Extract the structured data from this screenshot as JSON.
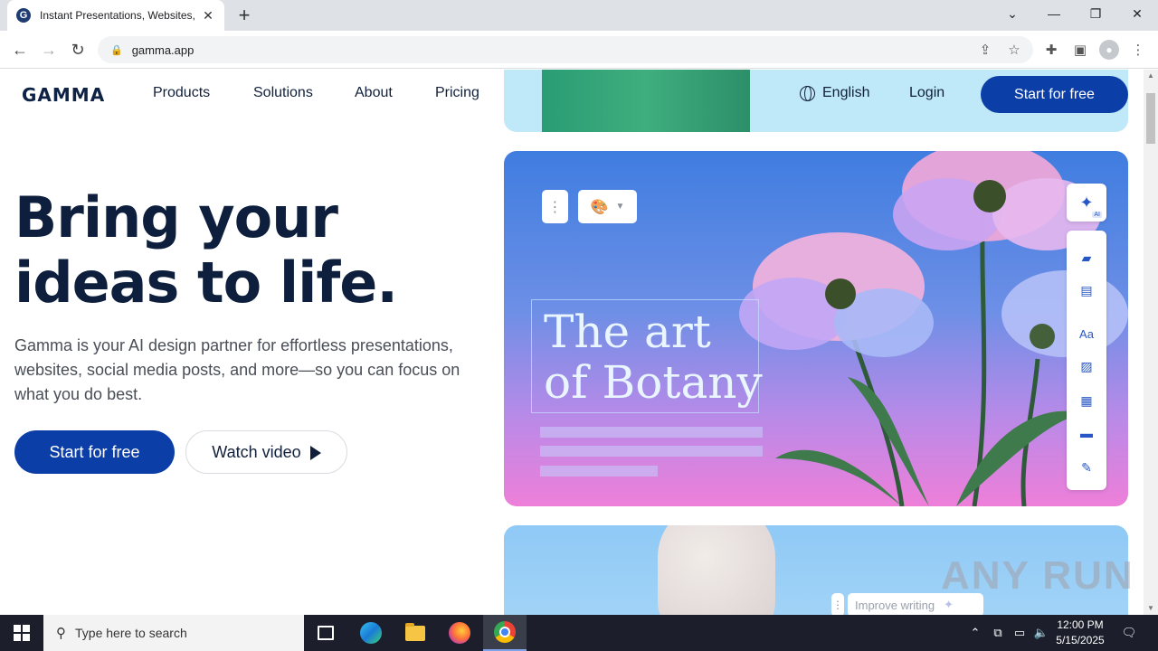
{
  "browser": {
    "tab_title": "Instant Presentations, Websites,",
    "favicon_letter": "G",
    "url": "gamma.app"
  },
  "nav": {
    "logo": "GAMMA",
    "links": [
      "Products",
      "Solutions",
      "About",
      "Pricing"
    ],
    "language": "English",
    "login": "Login",
    "cta": "Start for free"
  },
  "hero": {
    "title_line1": "Bring your",
    "title_line2": "ideas to life.",
    "subtitle": "Gamma is your AI design partner for effortless presentations, websites, social media posts, and more—so you can focus on what you do best.",
    "primary_button": "Start for free",
    "secondary_button": "Watch video"
  },
  "showcase": {
    "card_title_line1": "The art",
    "card_title_line2": "of Botany",
    "ai_badge": "AI",
    "font_tool_label": "Aa",
    "improve_writing": "Improve writing"
  },
  "watermark": "ANY RUN",
  "taskbar": {
    "search_placeholder": "Type here to search",
    "time": "12:00 PM",
    "date": "5/15/2025"
  },
  "colors": {
    "brand_navy": "#0d1f3c",
    "cta_blue": "#0c3ea8",
    "taskbar": "#1c1f2b"
  }
}
